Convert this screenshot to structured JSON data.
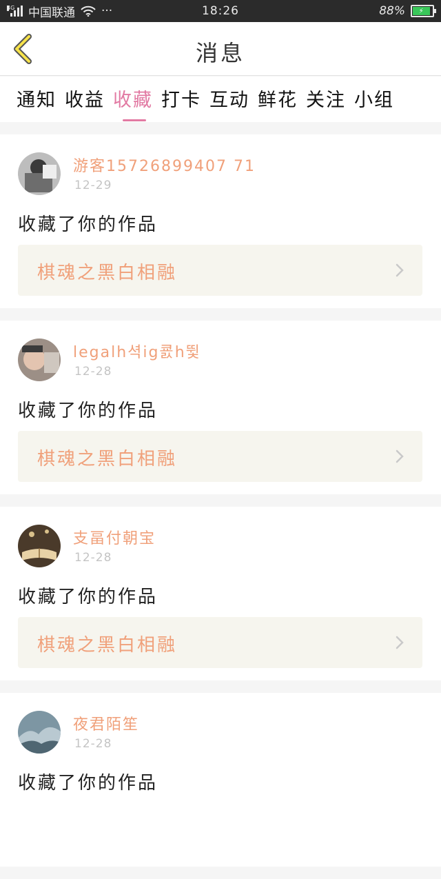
{
  "statusbar": {
    "network": "4G",
    "carrier": "中国联通",
    "dots": "···",
    "time": "18:26",
    "battery": "88%",
    "battery_level": 0.88
  },
  "navbar": {
    "back_icon": "chevron-left-icon",
    "title": "消息"
  },
  "tabs": [
    {
      "label": "通知",
      "active": false
    },
    {
      "label": "收益",
      "active": false
    },
    {
      "label": "收藏",
      "active": true
    },
    {
      "label": "打卡",
      "active": false
    },
    {
      "label": "互动",
      "active": false
    },
    {
      "label": "鲜花",
      "active": false
    },
    {
      "label": "关注",
      "active": false
    },
    {
      "label": "小组",
      "active": false
    }
  ],
  "colors": {
    "accent": "#e27aa3",
    "username": "#f0a07a",
    "work_bg": "#f6f5ee"
  },
  "messages": [
    {
      "username": "游客15726899407 71",
      "date": "12-29",
      "action": "收藏了你的作品",
      "work_title": "棋魂之黑白相融"
    },
    {
      "username": "legalh셕ig쿐h뜇",
      "date": "12-28",
      "action": "收藏了你的作品",
      "work_title": "棋魂之黑白相融"
    },
    {
      "username": "支畐付朝宝",
      "date": "12-28",
      "action": "收藏了你的作品",
      "work_title": "棋魂之黑白相融"
    },
    {
      "username": "夜君陌笙",
      "date": "12-28",
      "action": "收藏了你的作品",
      "work_title": ""
    }
  ]
}
